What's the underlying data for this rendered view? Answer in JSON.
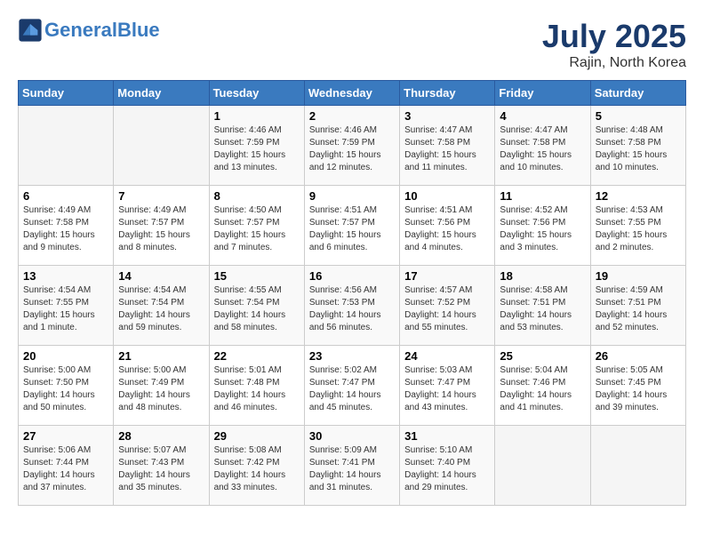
{
  "header": {
    "logo_text_general": "General",
    "logo_text_blue": "Blue",
    "month": "July 2025",
    "location": "Rajin, North Korea"
  },
  "days_of_week": [
    "Sunday",
    "Monday",
    "Tuesday",
    "Wednesday",
    "Thursday",
    "Friday",
    "Saturday"
  ],
  "weeks": [
    [
      {
        "day": "",
        "info": ""
      },
      {
        "day": "",
        "info": ""
      },
      {
        "day": "1",
        "info": "Sunrise: 4:46 AM\nSunset: 7:59 PM\nDaylight: 15 hours\nand 13 minutes."
      },
      {
        "day": "2",
        "info": "Sunrise: 4:46 AM\nSunset: 7:59 PM\nDaylight: 15 hours\nand 12 minutes."
      },
      {
        "day": "3",
        "info": "Sunrise: 4:47 AM\nSunset: 7:58 PM\nDaylight: 15 hours\nand 11 minutes."
      },
      {
        "day": "4",
        "info": "Sunrise: 4:47 AM\nSunset: 7:58 PM\nDaylight: 15 hours\nand 10 minutes."
      },
      {
        "day": "5",
        "info": "Sunrise: 4:48 AM\nSunset: 7:58 PM\nDaylight: 15 hours\nand 10 minutes."
      }
    ],
    [
      {
        "day": "6",
        "info": "Sunrise: 4:49 AM\nSunset: 7:58 PM\nDaylight: 15 hours\nand 9 minutes."
      },
      {
        "day": "7",
        "info": "Sunrise: 4:49 AM\nSunset: 7:57 PM\nDaylight: 15 hours\nand 8 minutes."
      },
      {
        "day": "8",
        "info": "Sunrise: 4:50 AM\nSunset: 7:57 PM\nDaylight: 15 hours\nand 7 minutes."
      },
      {
        "day": "9",
        "info": "Sunrise: 4:51 AM\nSunset: 7:57 PM\nDaylight: 15 hours\nand 6 minutes."
      },
      {
        "day": "10",
        "info": "Sunrise: 4:51 AM\nSunset: 7:56 PM\nDaylight: 15 hours\nand 4 minutes."
      },
      {
        "day": "11",
        "info": "Sunrise: 4:52 AM\nSunset: 7:56 PM\nDaylight: 15 hours\nand 3 minutes."
      },
      {
        "day": "12",
        "info": "Sunrise: 4:53 AM\nSunset: 7:55 PM\nDaylight: 15 hours\nand 2 minutes."
      }
    ],
    [
      {
        "day": "13",
        "info": "Sunrise: 4:54 AM\nSunset: 7:55 PM\nDaylight: 15 hours\nand 1 minute."
      },
      {
        "day": "14",
        "info": "Sunrise: 4:54 AM\nSunset: 7:54 PM\nDaylight: 14 hours\nand 59 minutes."
      },
      {
        "day": "15",
        "info": "Sunrise: 4:55 AM\nSunset: 7:54 PM\nDaylight: 14 hours\nand 58 minutes."
      },
      {
        "day": "16",
        "info": "Sunrise: 4:56 AM\nSunset: 7:53 PM\nDaylight: 14 hours\nand 56 minutes."
      },
      {
        "day": "17",
        "info": "Sunrise: 4:57 AM\nSunset: 7:52 PM\nDaylight: 14 hours\nand 55 minutes."
      },
      {
        "day": "18",
        "info": "Sunrise: 4:58 AM\nSunset: 7:51 PM\nDaylight: 14 hours\nand 53 minutes."
      },
      {
        "day": "19",
        "info": "Sunrise: 4:59 AM\nSunset: 7:51 PM\nDaylight: 14 hours\nand 52 minutes."
      }
    ],
    [
      {
        "day": "20",
        "info": "Sunrise: 5:00 AM\nSunset: 7:50 PM\nDaylight: 14 hours\nand 50 minutes."
      },
      {
        "day": "21",
        "info": "Sunrise: 5:00 AM\nSunset: 7:49 PM\nDaylight: 14 hours\nand 48 minutes."
      },
      {
        "day": "22",
        "info": "Sunrise: 5:01 AM\nSunset: 7:48 PM\nDaylight: 14 hours\nand 46 minutes."
      },
      {
        "day": "23",
        "info": "Sunrise: 5:02 AM\nSunset: 7:47 PM\nDaylight: 14 hours\nand 45 minutes."
      },
      {
        "day": "24",
        "info": "Sunrise: 5:03 AM\nSunset: 7:47 PM\nDaylight: 14 hours\nand 43 minutes."
      },
      {
        "day": "25",
        "info": "Sunrise: 5:04 AM\nSunset: 7:46 PM\nDaylight: 14 hours\nand 41 minutes."
      },
      {
        "day": "26",
        "info": "Sunrise: 5:05 AM\nSunset: 7:45 PM\nDaylight: 14 hours\nand 39 minutes."
      }
    ],
    [
      {
        "day": "27",
        "info": "Sunrise: 5:06 AM\nSunset: 7:44 PM\nDaylight: 14 hours\nand 37 minutes."
      },
      {
        "day": "28",
        "info": "Sunrise: 5:07 AM\nSunset: 7:43 PM\nDaylight: 14 hours\nand 35 minutes."
      },
      {
        "day": "29",
        "info": "Sunrise: 5:08 AM\nSunset: 7:42 PM\nDaylight: 14 hours\nand 33 minutes."
      },
      {
        "day": "30",
        "info": "Sunrise: 5:09 AM\nSunset: 7:41 PM\nDaylight: 14 hours\nand 31 minutes."
      },
      {
        "day": "31",
        "info": "Sunrise: 5:10 AM\nSunset: 7:40 PM\nDaylight: 14 hours\nand 29 minutes."
      },
      {
        "day": "",
        "info": ""
      },
      {
        "day": "",
        "info": ""
      }
    ]
  ]
}
